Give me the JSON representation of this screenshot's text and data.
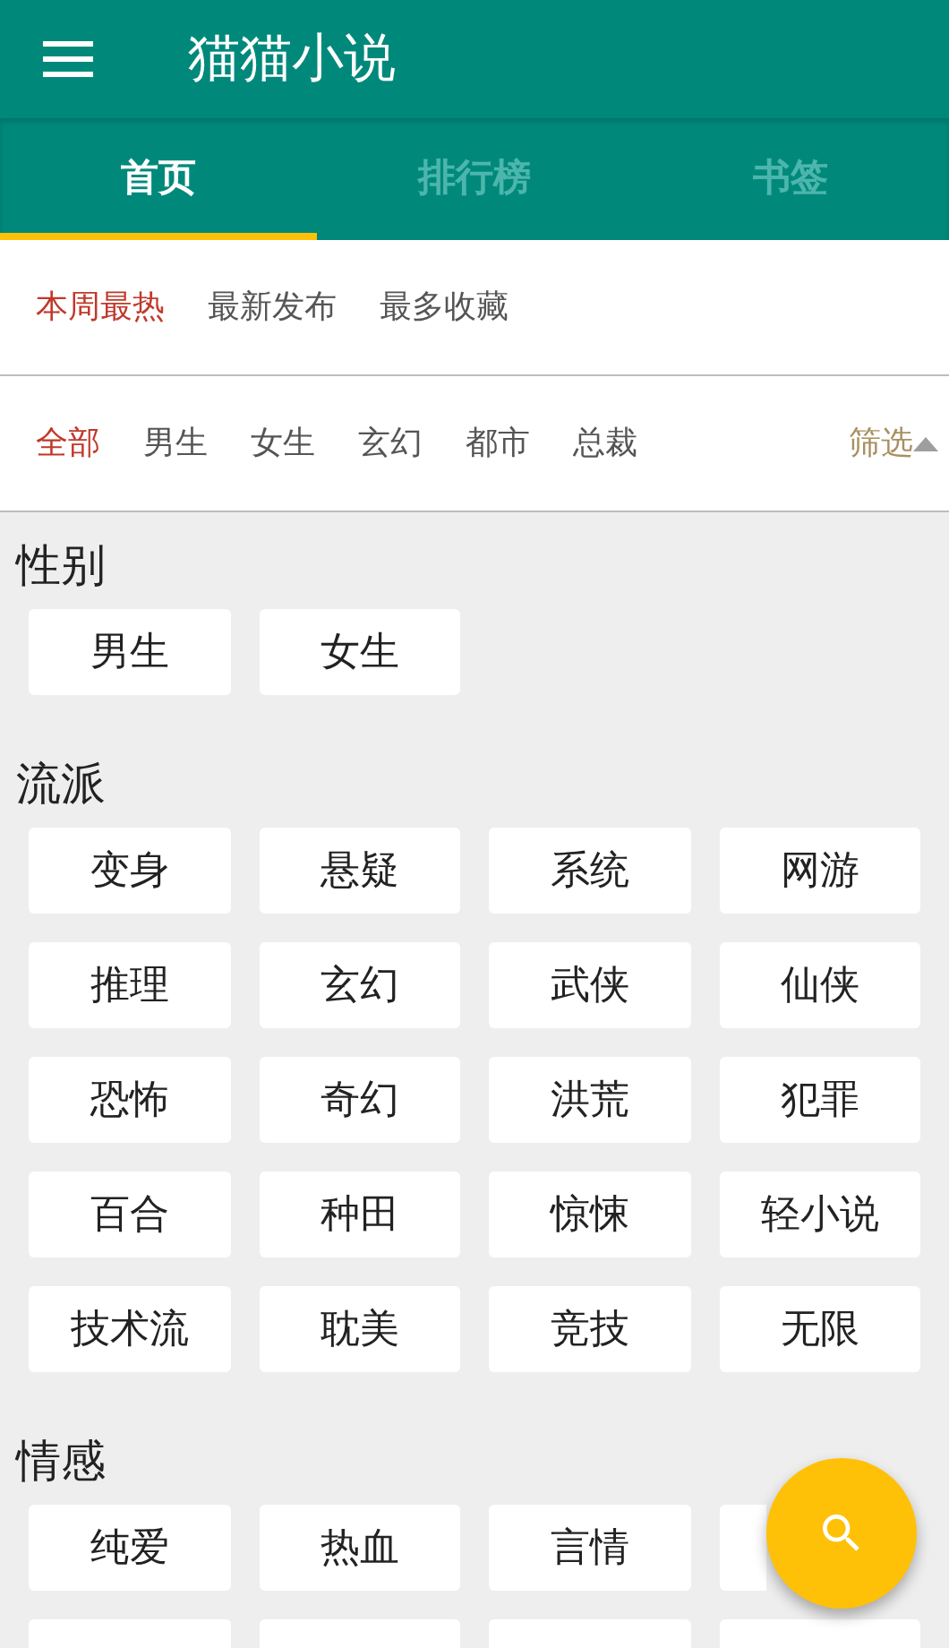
{
  "app_bar": {
    "title": "猫猫小说"
  },
  "tabs": [
    {
      "label": "首页",
      "selected": true
    },
    {
      "label": "排行榜",
      "selected": false
    },
    {
      "label": "书签",
      "selected": false
    }
  ],
  "sort_options": [
    {
      "label": "本周最热",
      "selected": true
    },
    {
      "label": "最新发布",
      "selected": false
    },
    {
      "label": "最多收藏",
      "selected": false
    }
  ],
  "category_filters": [
    {
      "label": "全部",
      "selected": true
    },
    {
      "label": "男生",
      "selected": false
    },
    {
      "label": "女生",
      "selected": false
    },
    {
      "label": "玄幻",
      "selected": false
    },
    {
      "label": "都市",
      "selected": false
    },
    {
      "label": "总裁",
      "selected": false
    }
  ],
  "filter_toggle": {
    "label": "筛选",
    "expanded": true
  },
  "sections": [
    {
      "title": "性别",
      "items": [
        {
          "kind": "tag",
          "label": "男生"
        },
        {
          "kind": "tag",
          "label": "女生"
        }
      ]
    },
    {
      "title": "流派",
      "items": [
        {
          "kind": "tag",
          "label": "变身"
        },
        {
          "kind": "tag",
          "label": "悬疑"
        },
        {
          "kind": "tag",
          "label": "系统"
        },
        {
          "kind": "tag",
          "label": "网游"
        },
        {
          "kind": "tag",
          "label": "推理"
        },
        {
          "kind": "tag",
          "label": "玄幻"
        },
        {
          "kind": "tag",
          "label": "武侠"
        },
        {
          "kind": "tag",
          "label": "仙侠"
        },
        {
          "kind": "tag",
          "label": "恐怖"
        },
        {
          "kind": "tag",
          "label": "奇幻"
        },
        {
          "kind": "tag",
          "label": "洪荒"
        },
        {
          "kind": "tag",
          "label": "犯罪"
        },
        {
          "kind": "tag",
          "label": "百合"
        },
        {
          "kind": "tag",
          "label": "种田"
        },
        {
          "kind": "tag",
          "label": "惊悚"
        },
        {
          "kind": "tag",
          "label": "轻小说"
        },
        {
          "kind": "tag",
          "label": "技术流"
        },
        {
          "kind": "tag",
          "label": "耽美"
        },
        {
          "kind": "tag",
          "label": "竞技"
        },
        {
          "kind": "tag",
          "label": "无限"
        }
      ]
    },
    {
      "title": "情感",
      "items": [
        {
          "kind": "tag",
          "label": "纯爱"
        },
        {
          "kind": "tag",
          "label": "热血"
        },
        {
          "kind": "tag",
          "label": "言情"
        },
        {
          "kind": "covered"
        },
        {
          "kind": "blank"
        },
        {
          "kind": "blank"
        },
        {
          "kind": "blank"
        },
        {
          "kind": "blank"
        }
      ]
    }
  ]
}
